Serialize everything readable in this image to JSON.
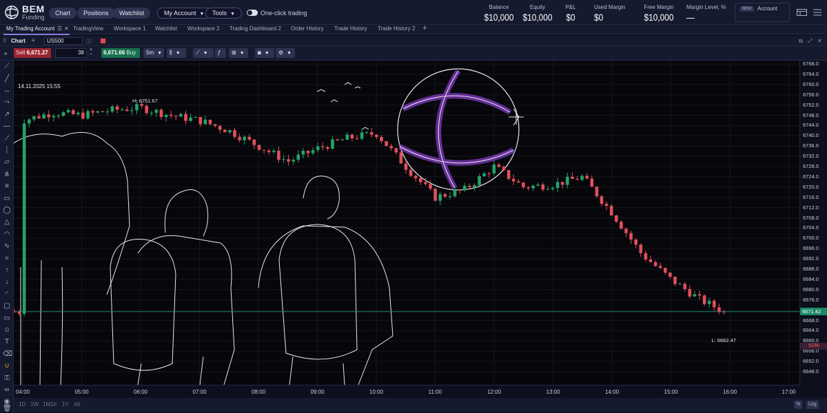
{
  "brand": {
    "name": "BEM",
    "sub": "Funding"
  },
  "header": {
    "nav": [
      "Chart",
      "Positions",
      "Watchlist"
    ],
    "menus": [
      "My Account",
      "Tools"
    ],
    "one_click_label": "One-click trading",
    "stats": [
      {
        "label": "Balance",
        "value": "$10,000"
      },
      {
        "label": "Equity",
        "value": "$10,000"
      },
      {
        "label": "P&L",
        "value": "$0"
      },
      {
        "label": "Used Margin",
        "value": "$0"
      },
      {
        "label": "Free Margin",
        "value": "$10,000"
      },
      {
        "label": "Margin Level, %",
        "value": "—"
      }
    ],
    "account_badge": "BEM",
    "account_label": "Account"
  },
  "tabs": [
    "My Trading Account",
    "TradingView",
    "Workspace 1",
    "Watchlist",
    "Workspace 2",
    "Trading Dashboard 2",
    "Order History",
    "Trade History",
    "Trade History 2"
  ],
  "panel": {
    "title": "Chart",
    "symbol": "US500"
  },
  "toolbar": {
    "sell_label": "Sell",
    "sell_price": "6,671.27",
    "quantity": "38",
    "buy_price": "6,671.66",
    "buy_label": "Buy",
    "interval": "5m"
  },
  "chart": {
    "datestamp": "14.11.2025 15:55",
    "high_label": "H: 6751.67",
    "low_label": "L: 6662.47",
    "current_price": "6671.42",
    "countdown": "523K",
    "up_color": "#26a269",
    "down_color": "#e0505c",
    "price_line_color": "#1a8a66"
  },
  "chart_data": {
    "type": "candlestick",
    "x": [
      "04:00",
      "04:30",
      "05:00",
      "05:30",
      "06:00",
      "06:30",
      "07:00",
      "07:30",
      "08:00",
      "08:30",
      "09:00",
      "09:30",
      "10:00",
      "10:30",
      "11:00",
      "11:30",
      "12:00",
      "12:30",
      "13:00",
      "13:30",
      "14:00",
      "14:30",
      "15:00",
      "15:30",
      "15:55"
    ],
    "close": [
      6746,
      6749,
      6748,
      6750,
      6751,
      6748,
      6746,
      6742,
      6736,
      6730,
      6735,
      6739,
      6741,
      6728,
      6716,
      6719,
      6728,
      6720,
      6721,
      6724,
      6710,
      6694,
      6684,
      6676,
      6671.42
    ],
    "high": 6751.67,
    "low": 6662.47,
    "last": 6671.42,
    "ylim": [
      6648,
      6768
    ],
    "y_ticks": [
      6768,
      6764,
      6760,
      6756,
      6752,
      6748,
      6744,
      6740,
      6736,
      6732,
      6728,
      6724,
      6720,
      6716,
      6712,
      6708,
      6704,
      6700,
      6696,
      6692,
      6688,
      6684,
      6680,
      6676,
      6672,
      6668,
      6664,
      6660,
      6656,
      6652,
      6648
    ],
    "x_ticks": [
      "04:00",
      "05:00",
      "06:00",
      "07:00",
      "08:00",
      "09:00",
      "10:00",
      "11:00",
      "12:00",
      "13:00",
      "14:00",
      "15:00",
      "16:00",
      "17:00"
    ]
  },
  "bottom": {
    "ranges": [
      "1D",
      "1W",
      "1M1h",
      "1Y",
      "All"
    ],
    "percent": "%",
    "log": "Log"
  }
}
